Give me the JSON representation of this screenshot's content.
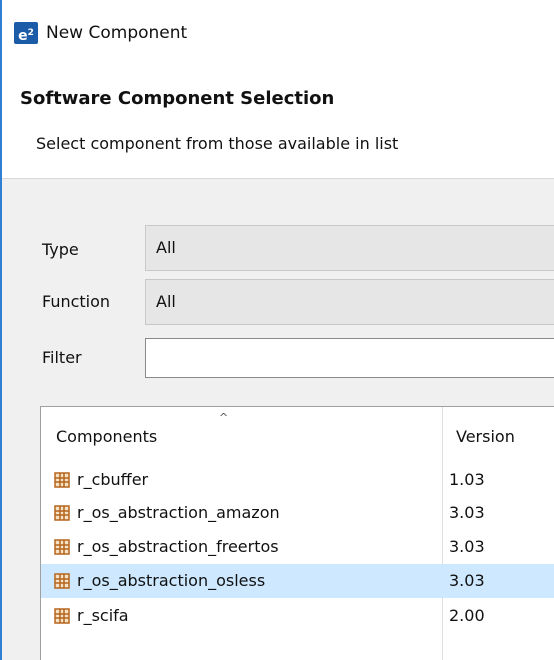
{
  "window": {
    "logo_text": "e",
    "logo_sup": "2",
    "title": "New Component"
  },
  "header": {
    "title": "Software Component Selection",
    "description": "Select component from those available in list"
  },
  "form": {
    "type_label": "Type",
    "type_value": "All",
    "function_label": "Function",
    "function_value": "All",
    "filter_label": "Filter",
    "filter_value": ""
  },
  "table": {
    "columns": [
      "Components",
      "Version"
    ],
    "sort_indicator": "^",
    "rows": [
      {
        "name": "r_cbuffer",
        "version": "1.03",
        "icon": "package-icon",
        "selected": false
      },
      {
        "name": "r_os_abstraction_amazon",
        "version": "3.03",
        "icon": "package-icon",
        "selected": false
      },
      {
        "name": "r_os_abstraction_freertos",
        "version": "3.03",
        "icon": "package-icon",
        "selected": false
      },
      {
        "name": "r_os_abstraction_osless",
        "version": "3.03",
        "icon": "package-icon",
        "selected": true
      },
      {
        "name": "r_scifa",
        "version": "2.00",
        "icon": "package-icon",
        "selected": false
      }
    ]
  },
  "colors": {
    "accent": "#2f7fd3",
    "selection": "#cde8ff",
    "icon": "#b5651d",
    "logo": "#1c5ba8"
  }
}
